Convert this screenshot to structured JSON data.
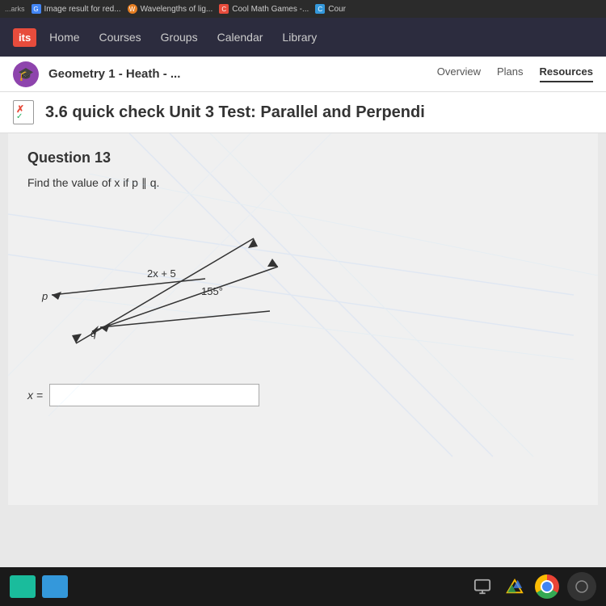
{
  "browser": {
    "tabs": [
      {
        "id": "google",
        "label": "Image result for red...",
        "favicon_type": "google",
        "favicon_letter": "G"
      },
      {
        "id": "wavelengths",
        "label": "Wavelengths of lig...",
        "favicon_type": "wavelength",
        "favicon_letter": "W"
      },
      {
        "id": "coolmath",
        "label": "Cool Math Games -...",
        "favicon_type": "coolmath",
        "favicon_letter": "C"
      },
      {
        "id": "cour",
        "label": "Cour",
        "favicon_type": "cour",
        "favicon_letter": "C"
      }
    ]
  },
  "lms": {
    "logo": "its",
    "nav_links": [
      "Home",
      "Courses",
      "Groups",
      "Calendar",
      "Library"
    ]
  },
  "course": {
    "title": "Geometry 1 - Heath - ...",
    "icon": "🎓",
    "tabs": [
      "Overview",
      "Plans",
      "Resources"
    ],
    "active_tab": "Resources"
  },
  "assignment": {
    "title": "3.6 quick check Unit 3 Test: Parallel and Perpendi"
  },
  "question": {
    "number": "Question 13",
    "text": "Find the value of x if p ∥ q.",
    "expression1": "2x + 5",
    "expression2": "155°",
    "label_p": "p",
    "label_q": "q",
    "answer_label": "x =",
    "answer_placeholder": ""
  },
  "taskbar": {
    "btn1_label": "",
    "btn2_label": ""
  }
}
